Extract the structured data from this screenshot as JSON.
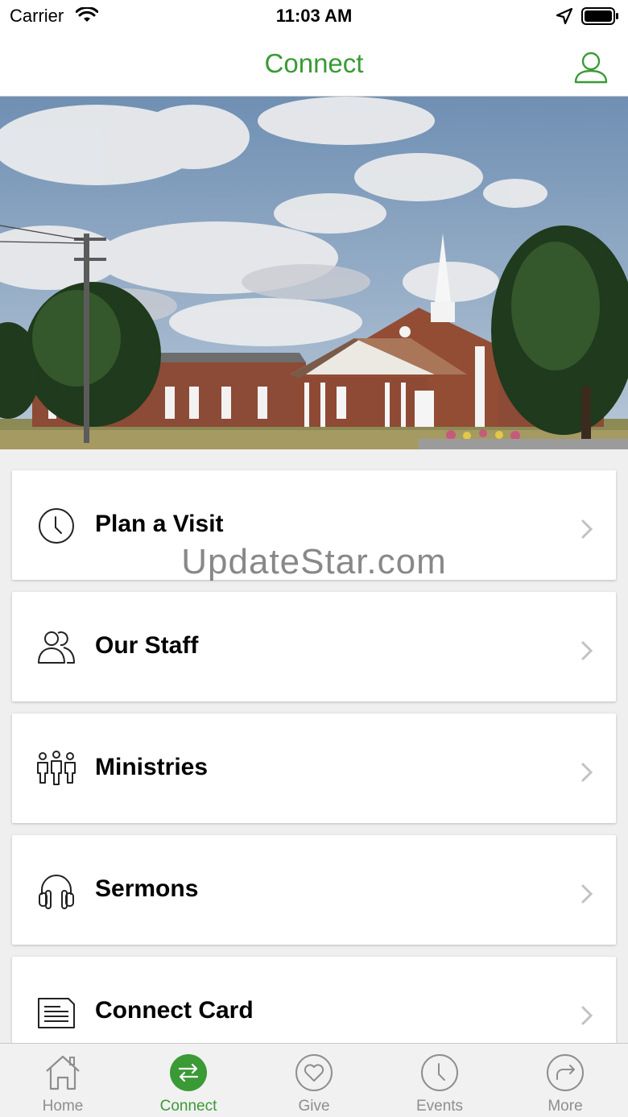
{
  "status_bar": {
    "carrier": "Carrier",
    "time": "11:03 AM"
  },
  "header": {
    "title": "Connect",
    "profile_icon": "person-icon"
  },
  "colors": {
    "accent": "#3a9a35",
    "inactive": "#8e8e8e",
    "background": "#efefef"
  },
  "watermark": "UpdateStar.com",
  "menu": {
    "items": [
      {
        "label": "Plan a Visit",
        "icon": "clock-icon"
      },
      {
        "label": "Our Staff",
        "icon": "people-icon"
      },
      {
        "label": "Ministries",
        "icon": "group-icon"
      },
      {
        "label": "Sermons",
        "icon": "headphones-icon"
      },
      {
        "label": "Connect Card",
        "icon": "document-icon"
      }
    ]
  },
  "tab_bar": {
    "tabs": [
      {
        "label": "Home",
        "icon": "home-icon",
        "active": false
      },
      {
        "label": "Connect",
        "icon": "connect-arrows-icon",
        "active": true
      },
      {
        "label": "Give",
        "icon": "heart-icon",
        "active": false
      },
      {
        "label": "Events",
        "icon": "clock-icon",
        "active": false
      },
      {
        "label": "More",
        "icon": "share-arrow-icon",
        "active": false
      }
    ]
  }
}
